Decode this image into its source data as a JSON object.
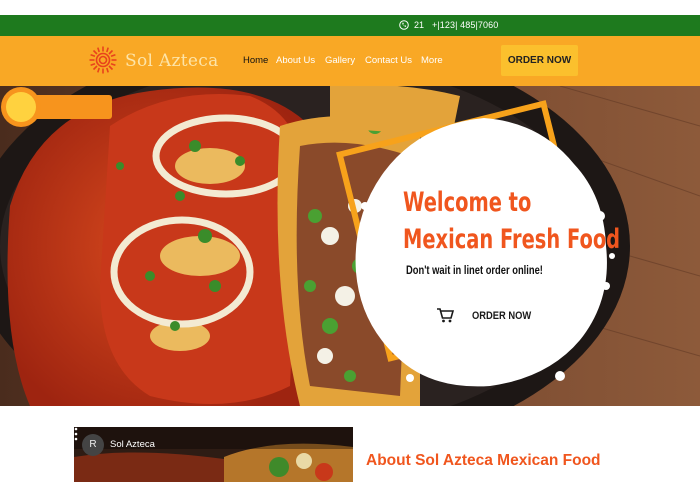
{
  "topbar": {
    "phone_icon": "phone-icon",
    "count": "21",
    "phone": "+|123| 485|7060"
  },
  "nav": {
    "logo_text": "Sol Azteca",
    "logo_icon": "sun-icon",
    "items": [
      {
        "label": "Home",
        "active": true
      },
      {
        "label": "About Us",
        "active": false
      },
      {
        "label": "Gallery",
        "active": false
      },
      {
        "label": "Contact Us",
        "active": false
      },
      {
        "label": "More",
        "active": false
      }
    ],
    "order_label": "ORDER NOW"
  },
  "hero": {
    "title_line1": "Welcome to",
    "title_line2": "Mexican Fresh Food",
    "tagline": "Don't wait in linet order online!",
    "button_label": "ORDER NOW",
    "button_icon": "cart-icon"
  },
  "about": {
    "video_channel_initial": "R",
    "video_title": "Sol Azteca",
    "video_menu_icon": "more-vert-icon",
    "title": "About Sol Azteca Mexican Food"
  },
  "colors": {
    "green": "#1e7a1e",
    "nav_orange": "#f9a825",
    "button_yellow": "#fbc02d",
    "accent": "#f0561e",
    "frame_orange": "#f7a21b"
  }
}
